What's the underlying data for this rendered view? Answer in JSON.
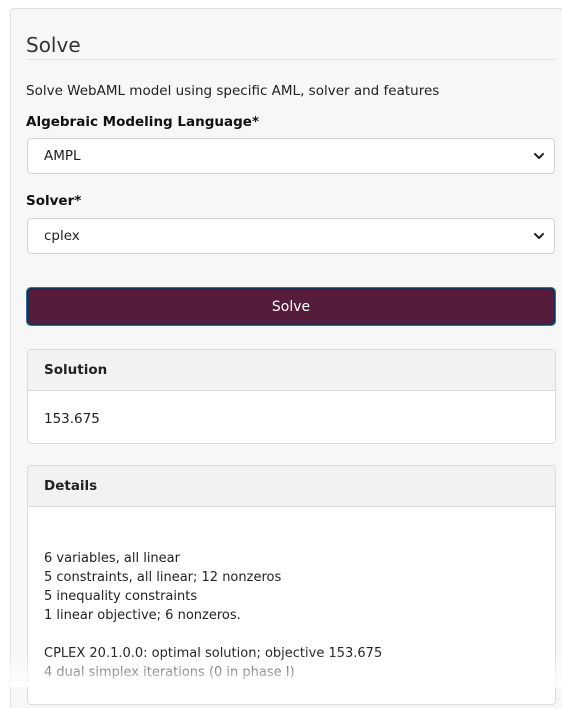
{
  "panel": {
    "title": "Solve",
    "description": "Solve WebAML model using specific AML, solver and features"
  },
  "aml_field": {
    "label": "Algebraic Modeling Language*",
    "value": "AMPL"
  },
  "solver_field": {
    "label": "Solver*",
    "value": "cplex"
  },
  "solve_button": {
    "label": "Solve",
    "color": "#561c3c"
  },
  "solution": {
    "header": "Solution",
    "value": "153.675"
  },
  "details": {
    "header": "Details",
    "text": "\n\n6 variables, all linear\n5 constraints, all linear; 12 nonzeros\n5 inequality constraints\n1 linear objective; 6 nonzeros.\n\nCPLEX 20.1.0.0: optimal solution; objective 153.675\n4 dual simplex iterations (0 in phase I)"
  },
  "icons": {
    "select_chevron": "chevron-down-icon"
  }
}
